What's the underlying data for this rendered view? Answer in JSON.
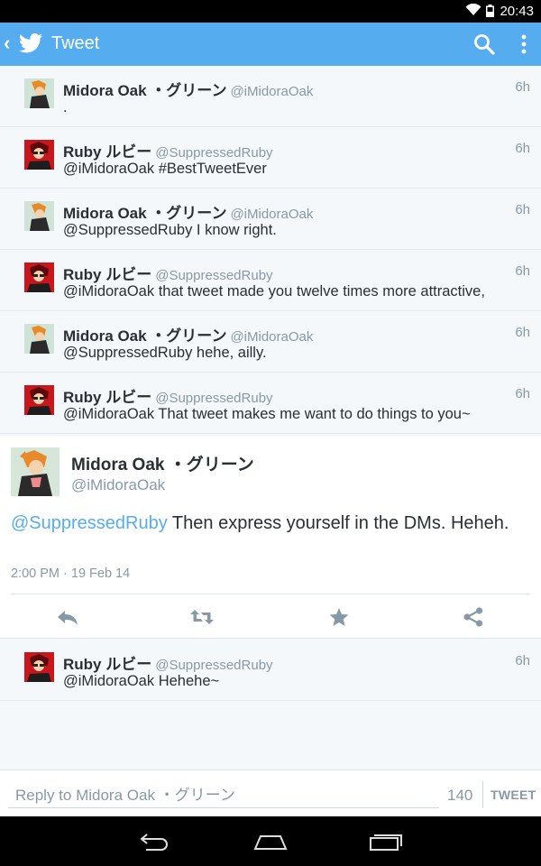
{
  "status_bar": {
    "time": "20:43"
  },
  "app_bar": {
    "title": "Tweet"
  },
  "conversation": [
    {
      "user": "Midora Oak ・グリーン",
      "handle": "@iMidoraOak",
      "time": "6h",
      "text": ".",
      "avatar": "midora"
    },
    {
      "user": "Ruby ルビー",
      "handle": "@SuppressedRuby",
      "time": "6h",
      "text": "@iMidoraOak #BestTweetEver",
      "avatar": "ruby"
    },
    {
      "user": "Midora Oak ・グリーン",
      "handle": "@iMidoraOak",
      "time": "6h",
      "text": "@SuppressedRuby I know right.",
      "avatar": "midora"
    },
    {
      "user": "Ruby ルビー",
      "handle": "@SuppressedRuby",
      "time": "6h",
      "text": "@iMidoraOak that tweet made you twelve times more attractive,",
      "avatar": "ruby"
    },
    {
      "user": "Midora Oak ・グリーン",
      "handle": "@iMidoraOak",
      "time": "6h",
      "text": "@SuppressedRuby hehe, ailly.",
      "avatar": "midora"
    },
    {
      "user": "Ruby ルビー",
      "handle": "@SuppressedRuby",
      "time": "6h",
      "text": "@iMidoraOak That tweet makes me want to do things to you~",
      "avatar": "ruby"
    }
  ],
  "main_tweet": {
    "user": "Midora Oak ・グリーン",
    "handle": "@iMidoraOak",
    "mention": "@SuppressedRuby",
    "text": " Then express yourself in the DMs. Heheh.",
    "date": "2:00 PM · 19 Feb 14"
  },
  "reply": {
    "user": "Ruby ルビー",
    "handle": "@SuppressedRuby",
    "time": "6h",
    "text": "@iMidoraOak Hehehe~"
  },
  "composer": {
    "placeholder": "Reply to Midora Oak ・グリーン",
    "char_count": "140",
    "tweet_label": "TWEET"
  },
  "colors": {
    "accent": "#55acee",
    "muted": "#8899a6",
    "text": "#292f33",
    "divider": "#e1e8ed"
  }
}
